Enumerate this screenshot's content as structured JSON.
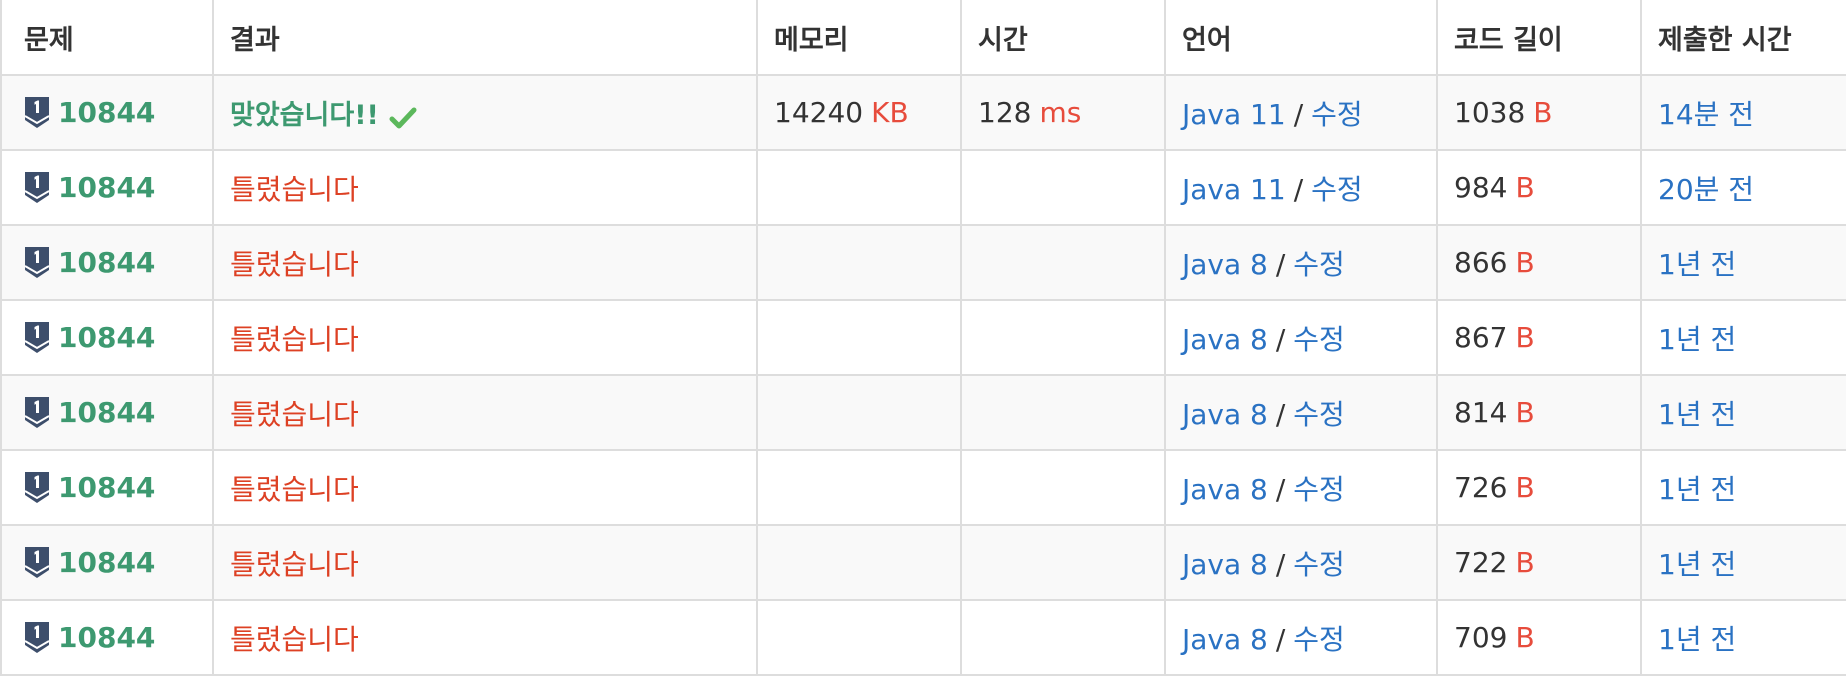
{
  "headers": {
    "problem": "문제",
    "result": "결과",
    "memory": "메모리",
    "time": "시간",
    "language": "언어",
    "code_length": "코드 길이",
    "submitted": "제출한 시간"
  },
  "units": {
    "memory": "KB",
    "time": "ms",
    "length": "B"
  },
  "edit_label": "수정",
  "separator": "/",
  "colors": {
    "accepted": "#3d9970",
    "wrong": "#dd4124",
    "link": "#2a72c3",
    "unit": "#e74c3c",
    "tier_badge": "#3d4e6b"
  },
  "rows": [
    {
      "problem": "10844",
      "tier_icon": "tier-badge-icon",
      "result": "맞았습니다!!",
      "status": "accepted",
      "memory": "14240",
      "time": "128",
      "language": "Java 11",
      "length": "1038",
      "submitted": "14분 전"
    },
    {
      "problem": "10844",
      "tier_icon": "tier-badge-icon",
      "result": "틀렸습니다",
      "status": "wrong",
      "memory": "",
      "time": "",
      "language": "Java 11",
      "length": "984",
      "submitted": "20분 전"
    },
    {
      "problem": "10844",
      "tier_icon": "tier-badge-icon",
      "result": "틀렸습니다",
      "status": "wrong",
      "memory": "",
      "time": "",
      "language": "Java 8",
      "length": "866",
      "submitted": "1년 전"
    },
    {
      "problem": "10844",
      "tier_icon": "tier-badge-icon",
      "result": "틀렸습니다",
      "status": "wrong",
      "memory": "",
      "time": "",
      "language": "Java 8",
      "length": "867",
      "submitted": "1년 전"
    },
    {
      "problem": "10844",
      "tier_icon": "tier-badge-icon",
      "result": "틀렸습니다",
      "status": "wrong",
      "memory": "",
      "time": "",
      "language": "Java 8",
      "length": "814",
      "submitted": "1년 전"
    },
    {
      "problem": "10844",
      "tier_icon": "tier-badge-icon",
      "result": "틀렸습니다",
      "status": "wrong",
      "memory": "",
      "time": "",
      "language": "Java 8",
      "length": "726",
      "submitted": "1년 전"
    },
    {
      "problem": "10844",
      "tier_icon": "tier-badge-icon",
      "result": "틀렸습니다",
      "status": "wrong",
      "memory": "",
      "time": "",
      "language": "Java 8",
      "length": "722",
      "submitted": "1년 전"
    },
    {
      "problem": "10844",
      "tier_icon": "tier-badge-icon",
      "result": "틀렸습니다",
      "status": "wrong",
      "memory": "",
      "time": "",
      "language": "Java 8",
      "length": "709",
      "submitted": "1년 전"
    }
  ]
}
